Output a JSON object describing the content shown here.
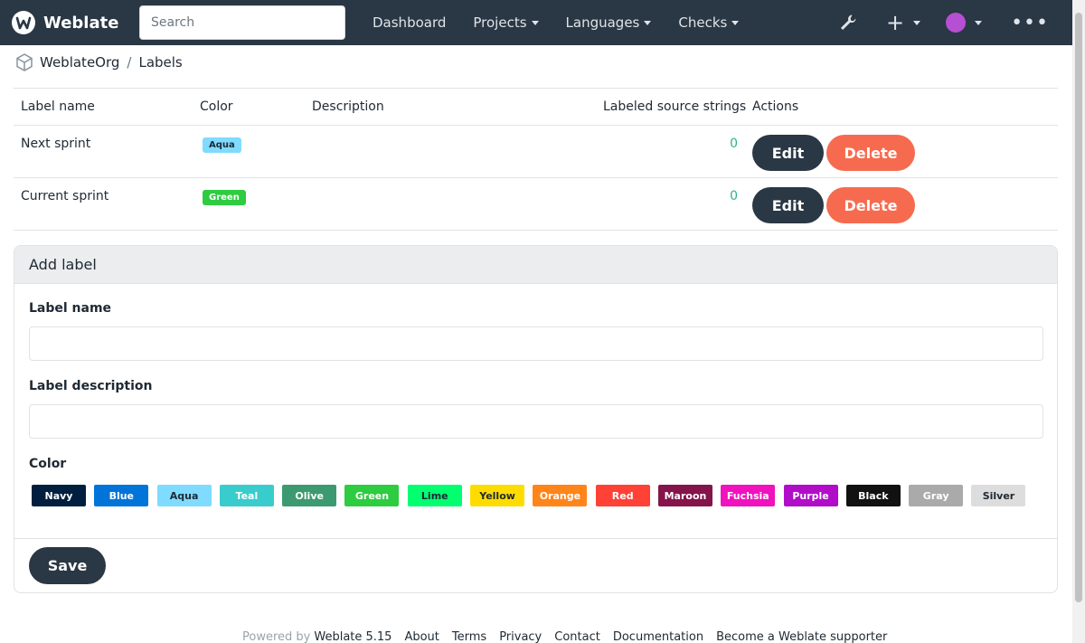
{
  "navbar": {
    "brand": "Weblate",
    "search_placeholder": "Search",
    "links": [
      {
        "label": "Dashboard",
        "dropdown": false
      },
      {
        "label": "Projects",
        "dropdown": true
      },
      {
        "label": "Languages",
        "dropdown": true
      },
      {
        "label": "Checks",
        "dropdown": true
      }
    ],
    "icons": [
      "wrench-icon",
      "plus-icon",
      "avatar",
      "more-icon"
    ]
  },
  "breadcrumb": {
    "items": [
      "WeblateOrg",
      "Labels"
    ],
    "separator": "/"
  },
  "table": {
    "headers": {
      "name": "Label name",
      "color": "Color",
      "description": "Description",
      "count": "Labeled source strings",
      "actions": "Actions"
    },
    "rows": [
      {
        "name": "Next sprint",
        "color_label": "Aqua",
        "color_hex": "#7fdbff",
        "description": "",
        "count": "0",
        "edit": "Edit",
        "delete": "Delete"
      },
      {
        "name": "Current sprint",
        "color_label": "Green",
        "color_hex": "#2ecc40",
        "description": "",
        "count": "0",
        "edit": "Edit",
        "delete": "Delete"
      }
    ]
  },
  "add_label": {
    "title": "Add label",
    "name_label": "Label name",
    "name_value": "",
    "description_label": "Label description",
    "description_value": "",
    "color_label": "Color",
    "colors": [
      {
        "name": "Navy",
        "hex": "#001f3f",
        "text": "#ffffff"
      },
      {
        "name": "Blue",
        "hex": "#0074d9",
        "text": "#ffffff"
      },
      {
        "name": "Aqua",
        "hex": "#7fdbff",
        "text": "#1f2933"
      },
      {
        "name": "Teal",
        "hex": "#39cccc",
        "text": "#ffffff"
      },
      {
        "name": "Olive",
        "hex": "#3d9970",
        "text": "#ffffff"
      },
      {
        "name": "Green",
        "hex": "#2ecc40",
        "text": "#ffffff"
      },
      {
        "name": "Lime",
        "hex": "#01ff70",
        "text": "#1f2933"
      },
      {
        "name": "Yellow",
        "hex": "#ffdc00",
        "text": "#1f2933"
      },
      {
        "name": "Orange",
        "hex": "#ff851b",
        "text": "#ffffff"
      },
      {
        "name": "Red",
        "hex": "#ff4136",
        "text": "#ffffff"
      },
      {
        "name": "Maroon",
        "hex": "#85144b",
        "text": "#ffffff"
      },
      {
        "name": "Fuchsia",
        "hex": "#f012be",
        "text": "#ffffff"
      },
      {
        "name": "Purple",
        "hex": "#b10dc9",
        "text": "#ffffff"
      },
      {
        "name": "Black",
        "hex": "#111111",
        "text": "#ffffff"
      },
      {
        "name": "Gray",
        "hex": "#aaaaaa",
        "text": "#ffffff"
      },
      {
        "name": "Silver",
        "hex": "#dddddd",
        "text": "#1f2933"
      }
    ],
    "save": "Save"
  },
  "footer": {
    "powered_by": "Powered by",
    "version": "Weblate 5.15",
    "links": [
      "About",
      "Terms",
      "Privacy",
      "Contact",
      "Documentation",
      "Become a Weblate supporter"
    ]
  },
  "colors": {
    "navbar": "#2a3744",
    "accent_dark": "#2a3744",
    "danger": "#f66b4f",
    "count_green": "#2eb67d"
  }
}
